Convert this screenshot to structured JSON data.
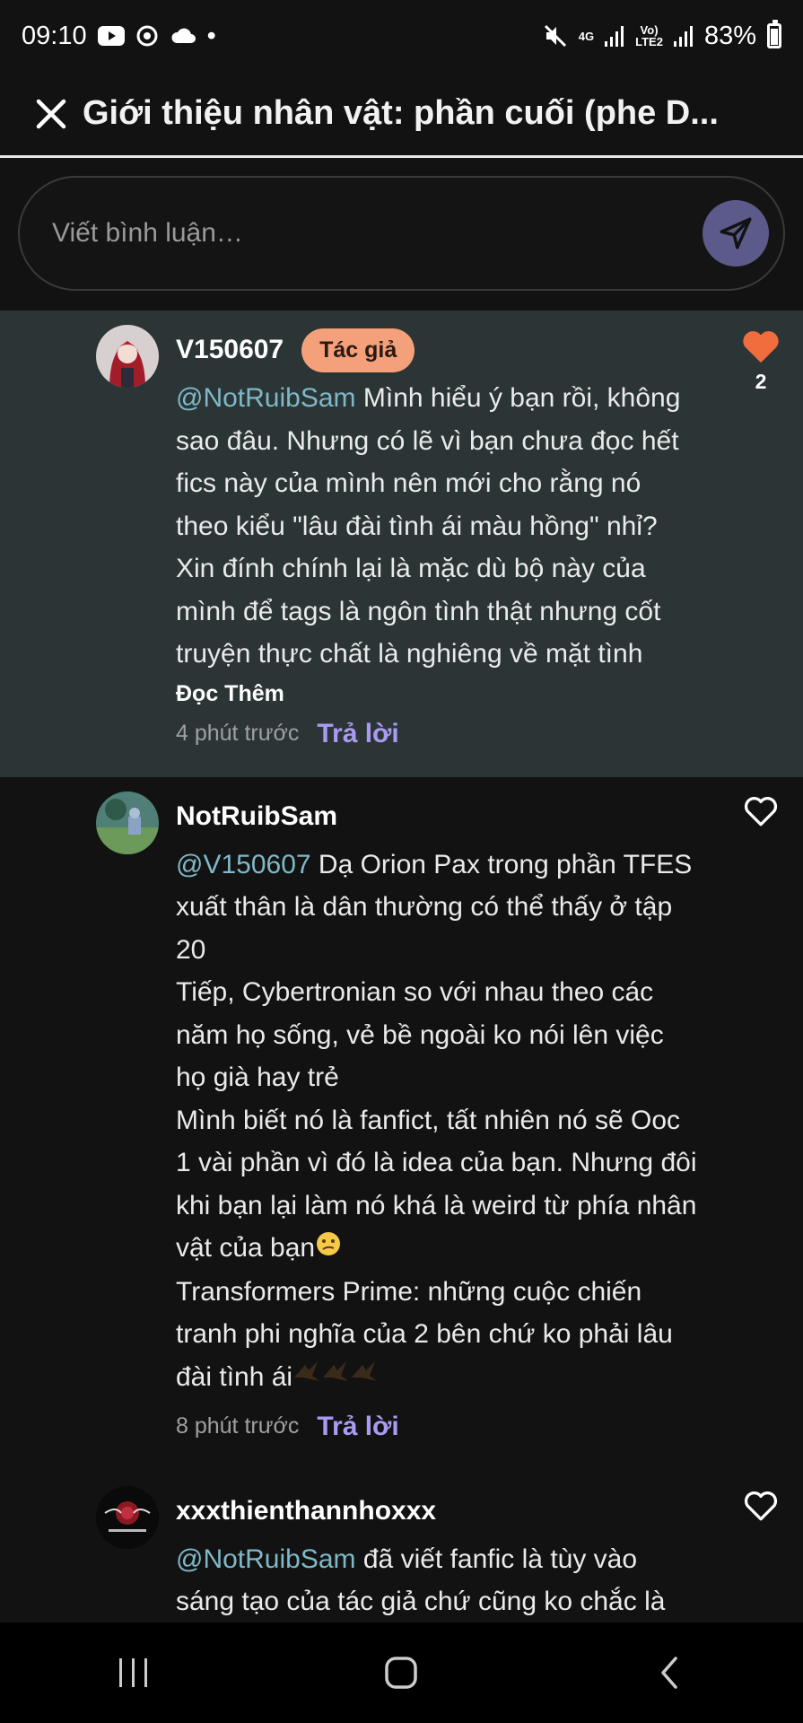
{
  "status_bar": {
    "time": "09:10",
    "dot": "•",
    "network_1": "4G",
    "network_2_top": "Vo)",
    "network_2_bottom": "LTE2",
    "battery": "83%"
  },
  "header": {
    "title": "Giới thiệu nhân vật: phần cuối (phe D..."
  },
  "comment_input": {
    "placeholder": "Viết bình luận…"
  },
  "comments": [
    {
      "username": "V150607",
      "badge": "Tác giả",
      "mention": "@NotRuibSam",
      "text": " Mình hiểu ý bạn rồi, không sao đâu. Nhưng có lẽ vì bạn chưa đọc hết fics này của mình nên mới cho rằng nó theo kiểu \"lâu đài tình ái màu hồng\" nhỉ? Xin đính chính lại là mặc dù bộ này của mình để tags là ngôn tình thật nhưng cốt truyện thực chất là nghiêng về mặt tình",
      "read_more": "Đọc Thêm",
      "time": "4 phút trước",
      "reply": "Trả lời",
      "likes": "2",
      "liked": true,
      "heart_color": "#f26d3d"
    },
    {
      "username": "NotRuibSam",
      "mention": "@V150607",
      "text_1": " Dạ Orion Pax trong phần TFES xuất thân là dân thường có thể thấy ở tập 20",
      "text_2": "Tiếp, Cybertronian so với nhau theo các năm họ sống, vẻ bề ngoài ko nói lên việc họ già hay trẻ",
      "text_3": "Mình biết nó là fanfict, tất nhiên nó sẽ Ooc 1 vài phần vì đó là idea của bạn. Nhưng đôi khi bạn lại làm nó khá là weird từ phía nhân vật của bạn",
      "text_4": "Transformers Prime: những cuộc chiến tranh phi nghĩa của 2 bên chứ ko phải lâu đài tình ái",
      "time": "8 phút trước",
      "reply": "Trả lời",
      "liked": false
    },
    {
      "username": "xxxthienthannhoxxx",
      "mention": "@NotRuibSam",
      "text": " đã viết fanfic là tùy vào sáng tạo của tác giả chứ cũng ko chắc là",
      "liked": false
    }
  ],
  "colors": {
    "accent_reply": "#a99bf2",
    "mention": "#7fb8c8",
    "badge_bg": "#f4a07a",
    "highlight_bg": "#2b3535",
    "send_button": "#5b5a8a"
  }
}
